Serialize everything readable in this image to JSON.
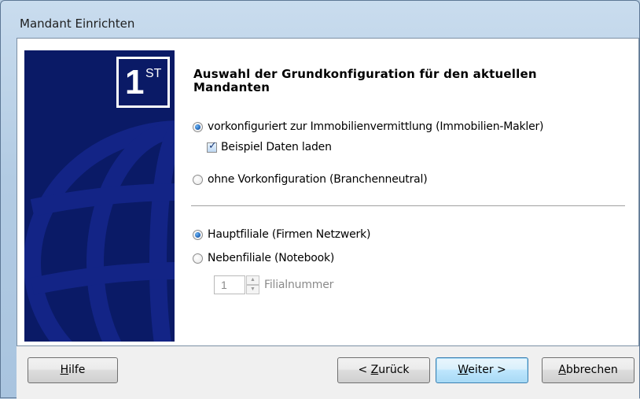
{
  "window": {
    "title": "Mandant Einrichten"
  },
  "banner": {
    "badge_number": "1",
    "badge_suffix": "ST"
  },
  "content": {
    "heading": "Auswahl der Grundkonfiguration für den aktuellen Mandanten",
    "config_options": [
      {
        "label": "vorkonfiguriert zur Immobilienvermittlung (Immobilien-Makler)",
        "selected": true
      },
      {
        "label": "ohne Vorkonfiguration (Branchenneutral)",
        "selected": false
      }
    ],
    "sample_data_checkbox": {
      "label": "Beispiel Daten laden",
      "checked": true
    },
    "branch_options": [
      {
        "label": "Hauptfiliale (Firmen Netzwerk)",
        "selected": true
      },
      {
        "label": "Nebenfiliale (Notebook)",
        "selected": false
      }
    ],
    "branch_number": {
      "value": "1",
      "label": "Filialnummer"
    }
  },
  "buttons": {
    "help": {
      "mnemonic": "H",
      "rest": "ilfe"
    },
    "back": {
      "prefix": "< ",
      "mnemonic": "Z",
      "rest": "urück"
    },
    "next": {
      "mnemonic": "W",
      "rest": "eiter >"
    },
    "cancel": {
      "mnemonic": "A",
      "rest": "bbrechen"
    }
  },
  "colors": {
    "banner_bg": "#0a1a66",
    "accent": "#1b5fb3"
  }
}
